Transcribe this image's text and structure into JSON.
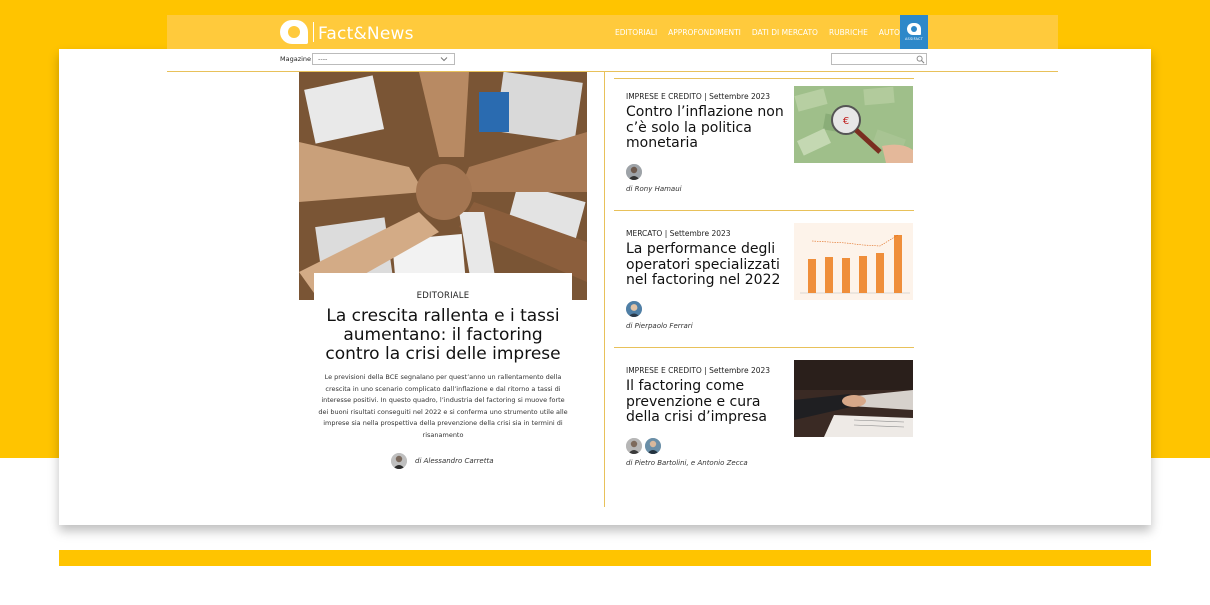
{
  "brand": {
    "name": "Fact&News",
    "badge_label": "ASSIFACT"
  },
  "nav": {
    "items": [
      "EDITORIALI",
      "APPROFONDIMENTI",
      "DATI DI MERCATO",
      "RUBRICHE",
      "AUTORI"
    ]
  },
  "filter": {
    "label": "Magazine",
    "selected": "----"
  },
  "featured": {
    "category": "EDITORIALE",
    "title": "La crescita rallenta e i tassi aumentano: il factoring contro la crisi delle imprese",
    "excerpt": "Le previsioni della BCE segnalano per quest’anno un rallentamento della crescita in uno scenario complicato dall’inflazione e dal ritorno a tassi di interesse positivi. In questo quadro, l’industria del factoring si muove forte dei buoni risultati conseguiti nel 2022 e si conferma uno strumento utile alle imprese sia nella prospettiva della prevenzione della crisi sia in termini di risanamento",
    "author": "di Alessandro Carretta"
  },
  "articles": [
    {
      "meta": "IMPRESE E CREDITO | Settembre 2023",
      "title": "Contro l’inflazione non c’è solo la politica monetaria",
      "author": "di Rony Hamaui"
    },
    {
      "meta": "MERCATO | Settembre 2023",
      "title": "La performance degli operatori specializzati nel factoring nel 2022",
      "author": "di Pierpaolo Ferrari"
    },
    {
      "meta": "IMPRESE E CREDITO | Settembre 2023",
      "title": "Il factoring come prevenzione e cura della crisi d’impresa",
      "author": "di Pietro Bartolini, e Antonio Zecca"
    }
  ],
  "colors": {
    "brand_yellow": "#ffc400",
    "header_yellow": "#ffca3c",
    "badge_blue": "#2e88c9",
    "divider": "#e8c15a"
  }
}
